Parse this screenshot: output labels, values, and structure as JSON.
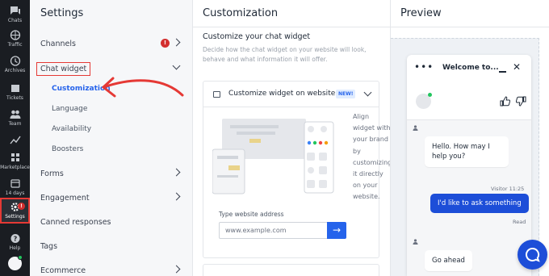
{
  "rail": {
    "items": [
      {
        "label": "Chats",
        "icon": "chat-icon"
      },
      {
        "label": "Traffic",
        "icon": "globe-icon"
      },
      {
        "label": "Archives",
        "icon": "clock-icon"
      },
      {
        "label": "Tickets",
        "icon": "ticket-icon"
      },
      {
        "label": "Team",
        "icon": "team-icon"
      },
      {
        "label": "Reports",
        "icon": "chart-icon"
      },
      {
        "label": "Marketplace",
        "icon": "grid-icon"
      },
      {
        "label": "14 days",
        "icon": "calendar-icon"
      },
      {
        "label": "Settings",
        "icon": "gear-icon",
        "badge": "!"
      },
      {
        "label": "Help",
        "icon": "help-icon"
      }
    ]
  },
  "settings": {
    "title": "Settings",
    "items": [
      {
        "label": "Channels",
        "badge": "!"
      },
      {
        "label": "Chat widget"
      },
      {
        "label": "Forms"
      },
      {
        "label": "Engagement"
      },
      {
        "label": "Canned responses"
      },
      {
        "label": "Tags"
      },
      {
        "label": "Ecommerce"
      }
    ],
    "chat_widget_sub": [
      "Customization",
      "Language",
      "Availability",
      "Boosters"
    ]
  },
  "customization": {
    "title": "Customization",
    "heading": "Customize your chat widget",
    "description": "Decide how the chat widget on your website will look, behave and what information it will offer.",
    "card_title": "Customize widget on website",
    "new_badge": "NEW!",
    "aside_lines": [
      "Align",
      "widget with",
      "your brand",
      "by",
      "customizing",
      "it directly",
      "on your",
      "website."
    ],
    "address_label": "Type website address",
    "address_placeholder": "www.example.com",
    "go_arrow": "→"
  },
  "preview": {
    "title": "Preview",
    "widget_title": "Welcome to...",
    "dots": "•••",
    "close": "✕",
    "messages": {
      "greeting": "Hello. How may I help you?",
      "visitor_meta": "Visitor 11:25",
      "visitor_msg": "I'd like to ask something",
      "read": "Read",
      "reply": "Go ahead"
    }
  },
  "colors": {
    "accent": "#1d4ed8",
    "rail_bg": "#1a1d22",
    "highlight_red": "#e53935",
    "online_green": "#22c55e"
  }
}
